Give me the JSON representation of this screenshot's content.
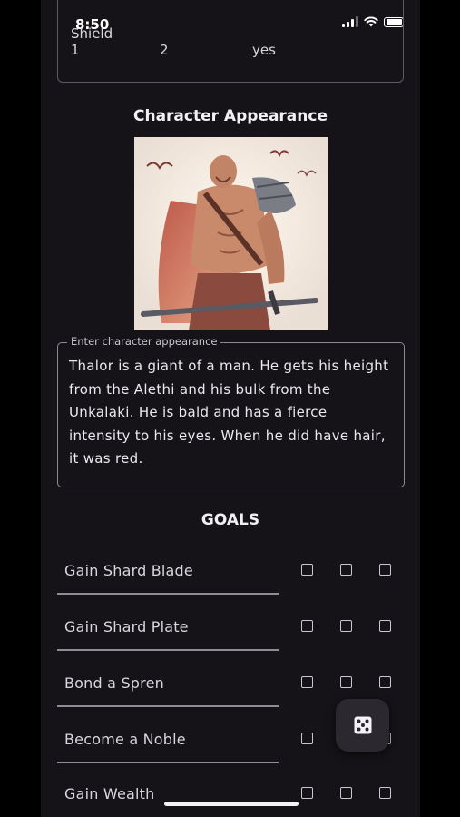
{
  "status_bar": {
    "time": "8:50"
  },
  "shield": {
    "label": "Shield",
    "values": [
      "1",
      "2",
      "yes"
    ]
  },
  "appearance": {
    "title": "Character Appearance",
    "field_label": "Enter character appearance",
    "text": "Thalor is a giant of a man. He gets his height from the Alethi and his bulk from the Unkalaki. He is bald and has a fierce intensity to his eyes. When he did have hair, it was red."
  },
  "goals": {
    "title": "GOALS",
    "items": [
      {
        "label": "Gain Shard Blade"
      },
      {
        "label": "Gain Shard Plate"
      },
      {
        "label": "Bond a Spren"
      },
      {
        "label": "Become a Noble"
      },
      {
        "label": "Gain Wealth"
      }
    ]
  },
  "colors": {
    "background": "#151317",
    "outline": "#8d8a93",
    "fab": "#2b282f"
  },
  "icons": {
    "dice_button": "dice-icon"
  }
}
